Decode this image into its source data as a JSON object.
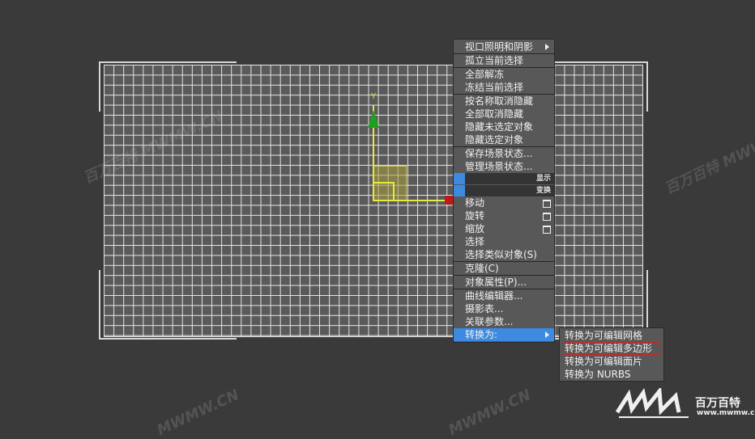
{
  "quad_menu": {
    "items": [
      "视口照明和阴影",
      "孤立当前选择",
      "全部解冻",
      "冻结当前选择",
      "按名称取消隐藏",
      "全部取消隐藏",
      "隐藏未选定对象",
      "隐藏选定对象",
      "保存场景状态...",
      "管理场景状态...",
      "移动",
      "旋转",
      "缩放",
      "选择",
      "选择类似对象(S)",
      "克隆(C)",
      "对象属性(P)...",
      "曲线编辑器...",
      "摄影表...",
      "关联参数...",
      "转换为:"
    ],
    "display_header": "显示",
    "transform_header": "变换"
  },
  "submenu": {
    "items": [
      "转换为可编辑网格",
      "转换为可编辑多边形",
      "转换为可编辑面片",
      "转换为 NURBS"
    ],
    "selected_index": 1
  },
  "gizmo": {
    "y_label": "Y"
  },
  "watermark": {
    "texts": [
      "百万百特 MWMW.CN",
      "百万百特 MWW",
      "MWMW.CN",
      "MWMW.CN"
    ]
  },
  "logo": {
    "brand": "百万百特",
    "url": "www.mwmw.cn"
  },
  "colors": {
    "accent": "#3d8ae0",
    "menu_bg": "#585858",
    "selection_border": "#d42020",
    "x_axis_head": "#c01818",
    "y_arrow": "#20a020",
    "axis": "#e8e840"
  }
}
